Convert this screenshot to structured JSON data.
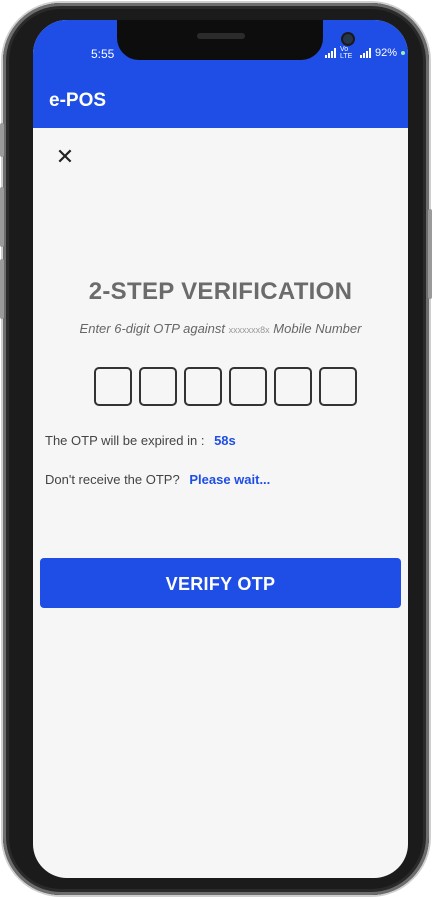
{
  "status_bar": {
    "time": "5:55",
    "signal_text": "Vo LTE",
    "battery": "92%"
  },
  "app_bar": {
    "title": "e-POS"
  },
  "verification": {
    "heading": "2-STEP VERIFICATION",
    "instruction_prefix": "Enter 6-digit OTP against",
    "masked_number": "xxxxxxx8x",
    "instruction_suffix": "Mobile Number",
    "otp_digits": [
      "",
      "",
      "",
      "",
      "",
      ""
    ],
    "expiry_label": "The OTP will be expired in :",
    "expiry_value": "58s",
    "resend_label": "Don't receive the OTP?",
    "resend_action": "Please wait..."
  },
  "actions": {
    "verify_label": "VERIFY OTP"
  },
  "colors": {
    "accent": "#1e4ee6",
    "background": "#f6f6f7"
  }
}
